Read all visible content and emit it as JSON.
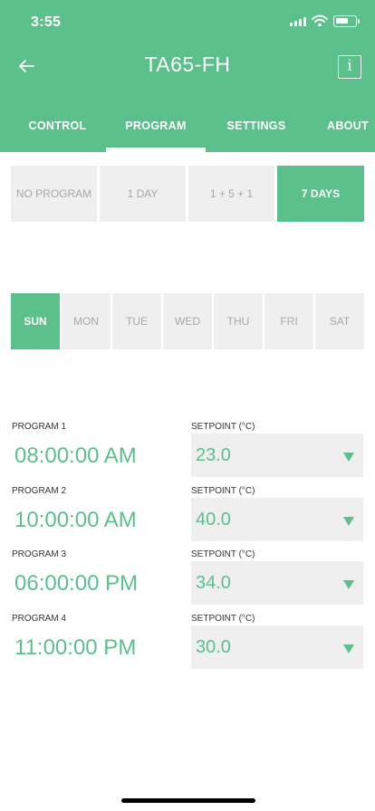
{
  "status_bar": {
    "time": "3:55"
  },
  "header": {
    "title": "TA65-FH",
    "info_label": "i"
  },
  "tabs": [
    {
      "label": "CONTROL"
    },
    {
      "label": "PROGRAM"
    },
    {
      "label": "SETTINGS"
    },
    {
      "label": "ABOUT"
    }
  ],
  "active_tab": "PROGRAM",
  "modes": [
    {
      "label": "NO PROGRAM"
    },
    {
      "label": "1 DAY"
    },
    {
      "label": "1 + 5 + 1"
    },
    {
      "label": "7 DAYS"
    }
  ],
  "selected_mode": "7 DAYS",
  "days": [
    {
      "label": "SUN"
    },
    {
      "label": "MON"
    },
    {
      "label": "TUE"
    },
    {
      "label": "WED"
    },
    {
      "label": "THU"
    },
    {
      "label": "FRI"
    },
    {
      "label": "SAT"
    }
  ],
  "selected_day": "SUN",
  "programs": [
    {
      "label": "PROGRAM 1",
      "time": "08:00:00 AM",
      "setpoint_label": "SETPOINT (°C)",
      "setpoint": "23.0"
    },
    {
      "label": "PROGRAM 2",
      "time": "10:00:00 AM",
      "setpoint_label": "SETPOINT (°C)",
      "setpoint": "40.0"
    },
    {
      "label": "PROGRAM 3",
      "time": "06:00:00 PM",
      "setpoint_label": "SETPOINT (°C)",
      "setpoint": "34.0"
    },
    {
      "label": "PROGRAM 4",
      "time": "11:00:00 PM",
      "setpoint_label": "SETPOINT (°C)",
      "setpoint": "30.0"
    }
  ],
  "colors": {
    "accent": "#5cc08d",
    "tile": "#efefef",
    "muted_text": "#a8a8a8"
  },
  "icons": {
    "back": "arrow-left-icon",
    "info": "info-icon",
    "dropdown": "triangle-down-icon"
  }
}
